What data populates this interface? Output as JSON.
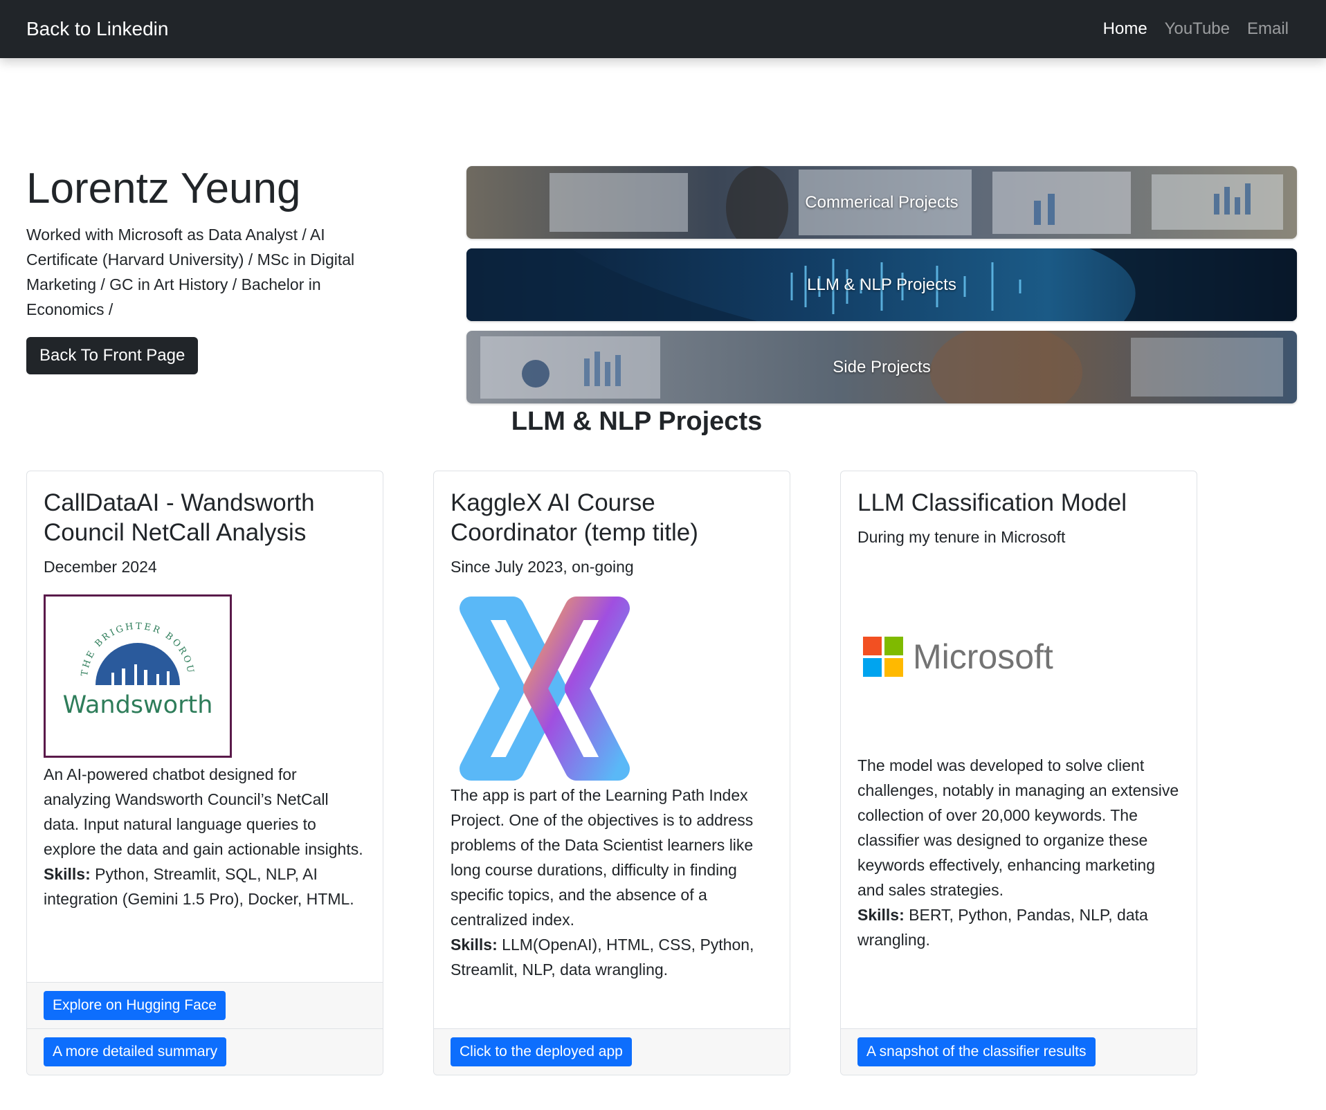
{
  "navbar": {
    "brand": "Back to Linkedin",
    "links": [
      {
        "label": "Home",
        "active": true
      },
      {
        "label": "YouTube",
        "active": false
      },
      {
        "label": "Email",
        "active": false
      }
    ]
  },
  "hero": {
    "name": "Lorentz Yeung",
    "description": "Worked with Microsoft as Data Analyst / AI Certificate (Harvard University) / MSc in Digital Marketing / GC in Art History / Bachelor in Economics /",
    "back_button": "Back To Front Page",
    "banners": [
      "Commerical Projects",
      "LLM & NLP Projects",
      "Side Projects"
    ]
  },
  "section_title": "LLM & NLP Projects",
  "cards": [
    {
      "title": "CallDataAI - Wandsworth Council NetCall Analysis",
      "subtitle": "December 2024",
      "logo_text": "Wandsworth",
      "logo_arc_text": "THE BRIGHTER BOROUGH",
      "description": "An AI-powered chatbot designed for analyzing Wandsworth Council’s NetCall data. Input natural language queries to explore the data and gain actionable insights.",
      "skills_label": "Skills:",
      "skills": " Python, Streamlit, SQL, NLP, AI integration (Gemini 1.5 Pro), Docker, HTML.",
      "buttons": [
        "Explore on Hugging Face",
        "A more detailed summary"
      ]
    },
    {
      "title": "KaggleX AI Course Coordinator (temp title)",
      "subtitle": "Since July 2023, on-going",
      "description": "The app is part of the Learning Path Index Project. One of the objectives is to address problems of the Data Scientist learners like long course durations, difficulty in finding specific topics, and the absence of a centralized index.",
      "skills_label": "Skills:",
      "skills": " LLM(OpenAI), HTML, CSS, Python, Streamlit, NLP, data wrangling.",
      "buttons": [
        "Click to the deployed app"
      ]
    },
    {
      "title": "LLM Classification Model",
      "subtitle": "During my tenure in Microsoft",
      "logo_text": "Microsoft",
      "description": "The model was developed to solve client challenges, notably in managing an extensive collection of over 20,000 keywords. The classifier was designed to organize these keywords effectively, enhancing marketing and sales strategies.",
      "skills_label": "Skills:",
      "skills": " BERT, Python, Pandas, NLP, data wrangling.",
      "buttons": [
        "A snapshot of the classifier results"
      ]
    }
  ],
  "colors": {
    "navbar": "#212529",
    "primary": "#0d6efd",
    "wandsworth_blue": "#2a5a9c",
    "wandsworth_green": "#2e7d5a",
    "ms_red": "#f25022",
    "ms_green": "#7fba00",
    "ms_blue": "#00a4ef",
    "ms_yellow": "#ffb900"
  }
}
